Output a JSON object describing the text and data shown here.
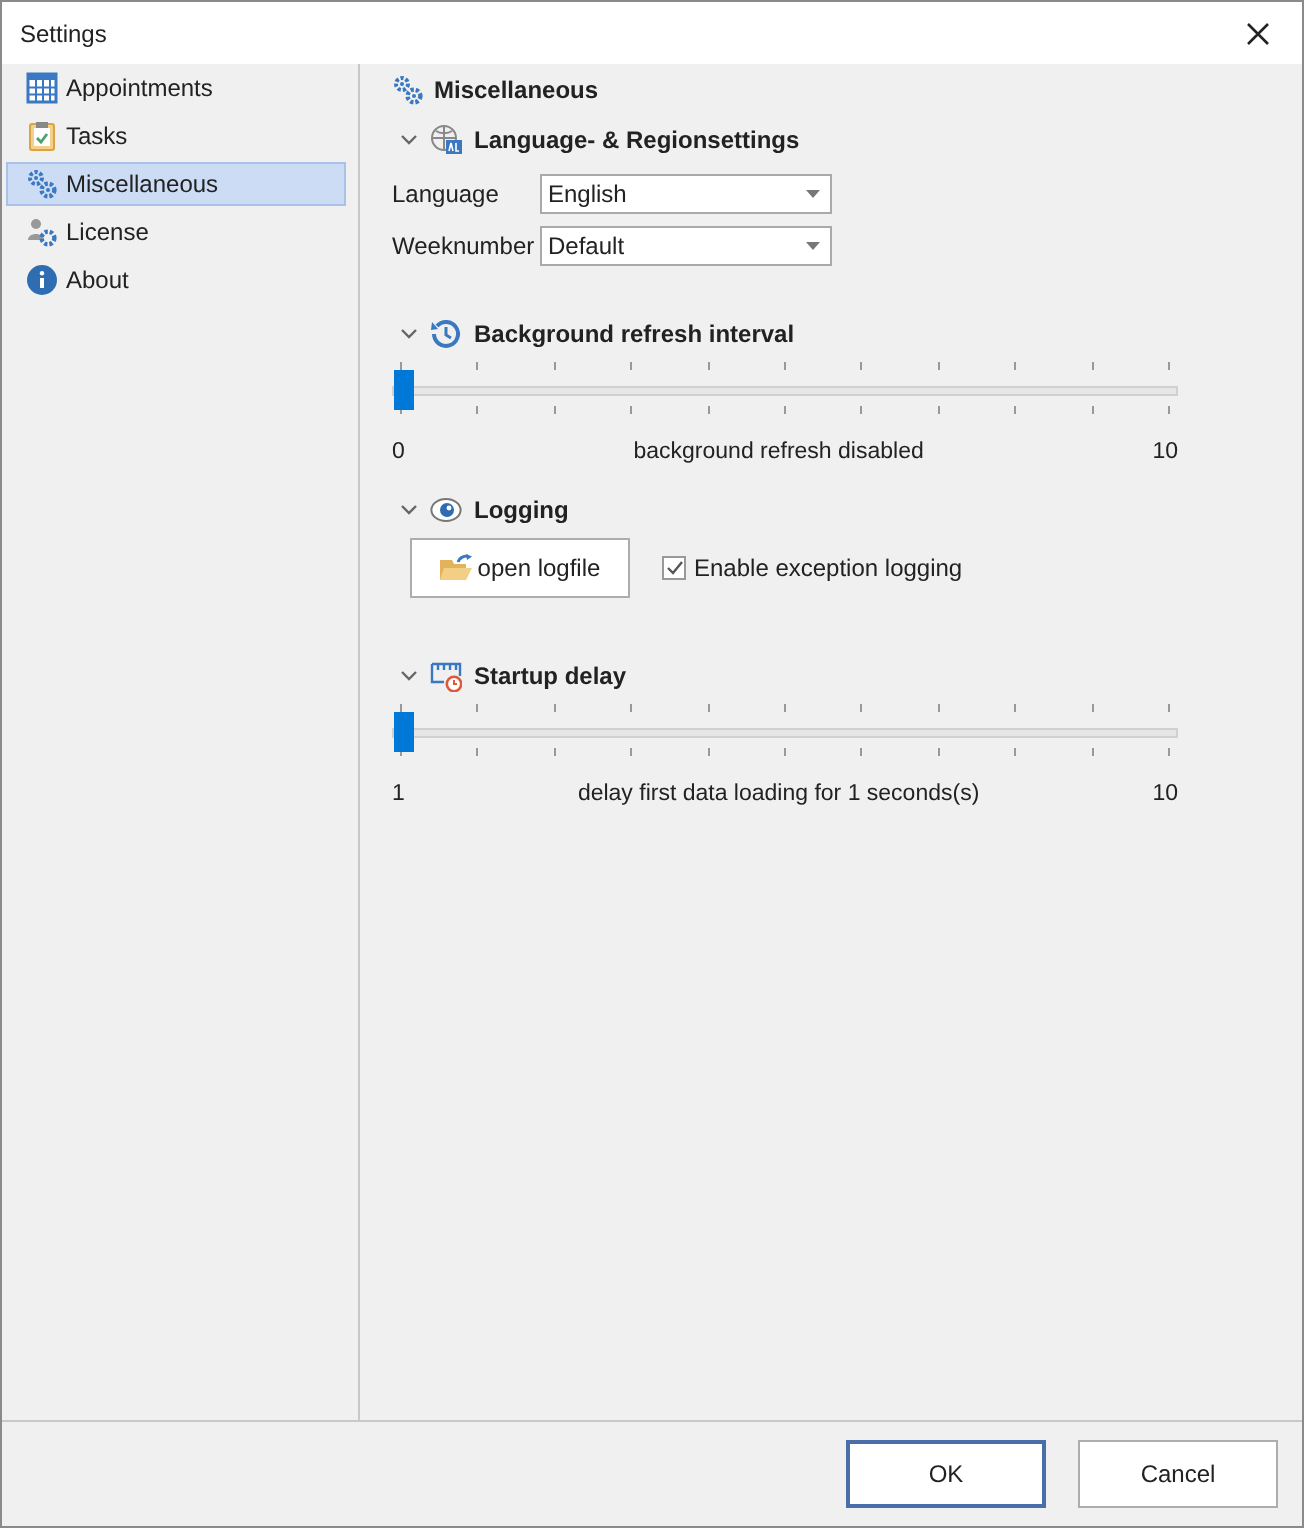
{
  "window": {
    "title": "Settings"
  },
  "sidebar": {
    "items": [
      {
        "label": "Appointments",
        "selected": false
      },
      {
        "label": "Tasks",
        "selected": false
      },
      {
        "label": "Miscellaneous",
        "selected": true
      },
      {
        "label": "License",
        "selected": false
      },
      {
        "label": "About",
        "selected": false
      }
    ]
  },
  "page": {
    "title": "Miscellaneous"
  },
  "sections": [
    {
      "kind": "fields",
      "title": "Language- & Regionsettings",
      "expanded": true,
      "fields": [
        {
          "label": "Language",
          "value": "English"
        },
        {
          "label": "Weeknumber",
          "value": "Default"
        }
      ]
    },
    {
      "kind": "slider",
      "title": "Background refresh interval",
      "expanded": true,
      "level": 0,
      "min": "0",
      "max": "10",
      "reading": "background refresh disabled"
    },
    {
      "kind": "logging",
      "title": "Logging",
      "expanded": true,
      "button": "open logfile",
      "checkbox": {
        "label": "Enable exception logging",
        "checked": true
      }
    },
    {
      "kind": "slider",
      "title": "Startup delay",
      "expanded": true,
      "level": 0,
      "min": "1",
      "max": "10",
      "reading": "delay first data loading for 1 seconds(s)"
    }
  ],
  "buttons": [
    {
      "label": "OK",
      "default": true
    },
    {
      "label": "Cancel",
      "default": false
    }
  ]
}
